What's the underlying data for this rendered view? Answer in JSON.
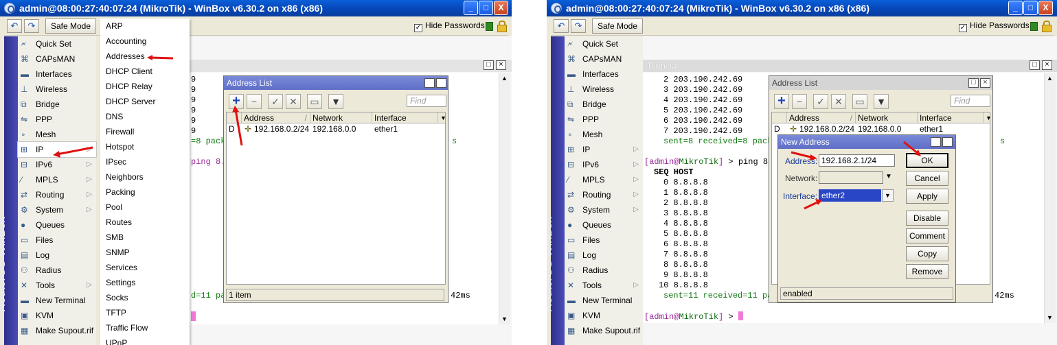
{
  "window_title": "admin@08:00:27:40:07:24 (MikroTik) - WinBox v6.30.2 on x86 (x86)",
  "window_controls": {
    "minimize": "_",
    "maximize": "□",
    "close": "X"
  },
  "toolbar": {
    "undo": "↶",
    "redo": "↷",
    "safe_mode": "Safe Mode",
    "hide_passwords": "Hide Passwords",
    "hide_passwords_checked": "✓"
  },
  "branding": "RouterOS WinBox",
  "menu": [
    {
      "label": "Quick Set",
      "icon": "quick-set-icon"
    },
    {
      "label": "CAPsMAN",
      "icon": "capsman-icon"
    },
    {
      "label": "Interfaces",
      "icon": "interfaces-icon"
    },
    {
      "label": "Wireless",
      "icon": "wireless-icon"
    },
    {
      "label": "Bridge",
      "icon": "bridge-icon"
    },
    {
      "label": "PPP",
      "icon": "ppp-icon"
    },
    {
      "label": "Mesh",
      "icon": "mesh-icon"
    },
    {
      "label": "IP",
      "icon": "ip-icon",
      "submenu": true
    },
    {
      "label": "IPv6",
      "icon": "ipv6-icon",
      "submenu": true
    },
    {
      "label": "MPLS",
      "icon": "mpls-icon",
      "submenu": true
    },
    {
      "label": "Routing",
      "icon": "routing-icon",
      "submenu": true
    },
    {
      "label": "System",
      "icon": "system-icon",
      "submenu": true
    },
    {
      "label": "Queues",
      "icon": "queues-icon"
    },
    {
      "label": "Files",
      "icon": "files-icon"
    },
    {
      "label": "Log",
      "icon": "log-icon"
    },
    {
      "label": "Radius",
      "icon": "radius-icon"
    },
    {
      "label": "Tools",
      "icon": "tools-icon",
      "submenu": true
    },
    {
      "label": "New Terminal",
      "icon": "terminal-icon"
    },
    {
      "label": "KVM",
      "icon": "kvm-icon"
    },
    {
      "label": "Make Supout.rif",
      "icon": "supout-icon"
    }
  ],
  "menu_submenu_arrow": "▷",
  "ip_submenu": [
    "ARP",
    "Accounting",
    "Addresses",
    "DHCP Client",
    "DHCP Relay",
    "DHCP Server",
    "DNS",
    "Firewall",
    "Hotspot",
    "IPsec",
    "Neighbors",
    "Packing",
    "Pool",
    "Routes",
    "SMB",
    "SNMP",
    "Services",
    "Settings",
    "Socks",
    "TFTP",
    "Traffic Flow",
    "UPnP"
  ],
  "left_terminal": {
    "partial_lines": [
      "9",
      "9",
      "9",
      "9",
      "9",
      "9"
    ],
    "sent_fragment": "=8 pack",
    "ping_fragment": "ping 8.",
    "sent2_fragment": "d=11 pa",
    "right_fragment1": "s",
    "right_fragment2": "42ms"
  },
  "address_list": {
    "title": "Address List",
    "find_placeholder": "Find",
    "columns": [
      "Address",
      "Network",
      "Interface"
    ],
    "rows": [
      {
        "flag": "D",
        "address": "192.168.0.2/24",
        "network": "192.168.0.0",
        "interface": "ether1"
      }
    ],
    "status": "1 item",
    "sort_glyph": "/"
  },
  "terminal": {
    "title": "Terminal",
    "lines_top": [
      "2 203.190.242.69",
      "3 203.190.242.69",
      "4 203.190.242.69",
      "5 203.190.242.69",
      "6 203.190.242.69",
      "7 203.190.242.69"
    ],
    "sent1": "sent=8 received=8 pack",
    "sent1_tail": "s",
    "prompt_user": "admin",
    "prompt_host": "MikroTik",
    "command": "ping 8.",
    "seq_host_header": "SEQ HOST",
    "seq_lines": [
      "0 8.8.8.8",
      "1 8.8.8.8",
      "2 8.8.8.8",
      "3 8.8.8.8",
      "4 8.8.8.8",
      "5 8.8.8.8",
      "6 8.8.8.8",
      "7 8.8.8.8",
      "8 8.8.8.8",
      "9 8.8.8.8",
      "10 8.8.8.8"
    ],
    "sent2": "sent=11 received=11 pa",
    "sent2_tail": "42ms",
    "final_prompt_suffix": " >"
  },
  "new_address": {
    "title": "New Address",
    "address_label": "Address:",
    "address_value": "192.168.2.1/24",
    "network_label": "Network:",
    "network_value": "",
    "interface_label": "Interface:",
    "interface_value": "ether2",
    "buttons": [
      "OK",
      "Cancel",
      "Apply",
      "Disable",
      "Comment",
      "Copy",
      "Remove"
    ],
    "status": "enabled"
  }
}
